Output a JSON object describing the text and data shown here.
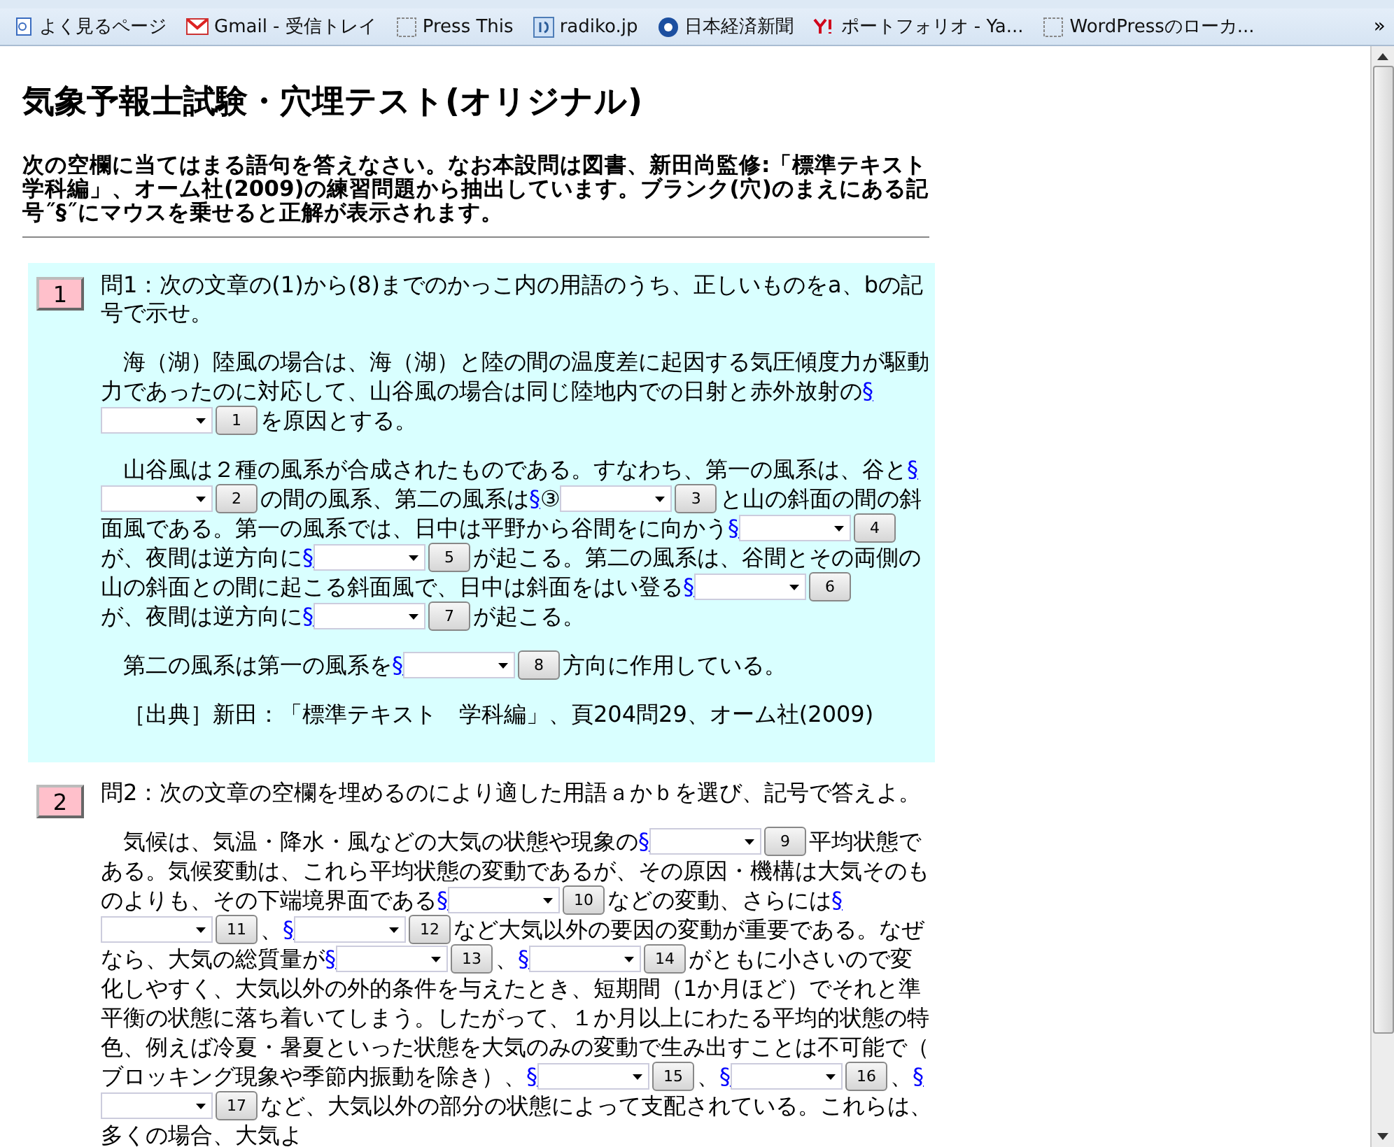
{
  "bookmarks": {
    "items": [
      {
        "label": "よく見るページ",
        "kind": "page"
      },
      {
        "label": "Gmail - 受信トレイ",
        "kind": "mail"
      },
      {
        "label": "Press This",
        "kind": "blank"
      },
      {
        "label": "radiko.jp",
        "kind": "radio"
      },
      {
        "label": "日本経済新聞",
        "kind": "news"
      },
      {
        "label": "ポートフォリオ - Ya...",
        "kind": "yahoo"
      },
      {
        "label": "WordPressのローカ...",
        "kind": "blank"
      }
    ],
    "more": "»"
  },
  "page": {
    "title": "気象予報士試験・穴埋テスト(オリジナル)",
    "intro": "次の空欄に当てはまる語句を答えなさい。なお本設問は図書、新田尚監修:「標準テキスト学科編」、オーム社(2009)の練習問題から抽出しています。ブランク(穴)のまえにある記号˝§˝にマウスを乗せると正解が表示されます。",
    "questions": [
      {
        "number": "1",
        "highlighted": true,
        "prompt": "問1：次の文章の(1)から(8)までのかっこ内の用語のうち、正しいものをa、bの記号で示せ。",
        "paragraphs": [
          [
            {
              "kind": "text",
              "text": "海（湖）陸風の場合は、海（湖）と陸の間の温度差に起因する気圧傾度力が駆動力であったのに対応して、山谷風の場合は同じ陸地内での日射と赤外放射の"
            },
            {
              "kind": "link",
              "text": "§"
            },
            {
              "kind": "blank",
              "button": "1"
            },
            {
              "kind": "text",
              "text": "を原因とする。"
            }
          ],
          [
            {
              "kind": "text",
              "text": "山谷風は２種の風系が合成されたものである。すなわち、第一の風系は、谷と"
            },
            {
              "kind": "link",
              "text": "§"
            },
            {
              "kind": "blank",
              "button": "2"
            },
            {
              "kind": "text",
              "text": "の間の風系、第二の風系は"
            },
            {
              "kind": "link",
              "text": "§"
            },
            {
              "kind": "text",
              "text": "③"
            },
            {
              "kind": "blank",
              "button": "3"
            },
            {
              "kind": "text",
              "text": "と山の斜面の間の斜面風である。第一の風系では、日中は平野から谷間をに向かう"
            },
            {
              "kind": "link",
              "text": "§"
            },
            {
              "kind": "blank",
              "button": "4"
            },
            {
              "kind": "text",
              "text": "が、夜間は逆方向に"
            },
            {
              "kind": "link",
              "text": "§"
            },
            {
              "kind": "blank",
              "button": "5"
            },
            {
              "kind": "text",
              "text": "が起こる。第二の風系は、谷間とその両側の山の斜面との間に起こる斜面風で、日中は斜面をはい登る"
            },
            {
              "kind": "link",
              "text": "§"
            },
            {
              "kind": "blank",
              "button": "6"
            },
            {
              "kind": "text",
              "text": "が、夜間は逆方向に"
            },
            {
              "kind": "link",
              "text": "§"
            },
            {
              "kind": "blank",
              "button": "7"
            },
            {
              "kind": "text",
              "text": "が起こる。"
            }
          ],
          [
            {
              "kind": "text",
              "text": "第二の風系は第一の風系を"
            },
            {
              "kind": "link",
              "text": "§"
            },
            {
              "kind": "blank",
              "button": "8"
            },
            {
              "kind": "text",
              "text": "方向に作用している。"
            }
          ],
          [
            {
              "kind": "text",
              "text": "［出典］新田：「標準テキスト　学科編」、頁204問29、オーム社(2009)"
            }
          ]
        ]
      },
      {
        "number": "2",
        "highlighted": false,
        "prompt": "問2：次の文章の空欄を埋めるのにより適した用語ａかｂを選び、記号で答えよ。",
        "paragraphs": [
          [
            {
              "kind": "text",
              "text": "気候は、気温・降水・風などの大気の状態や現象の"
            },
            {
              "kind": "link",
              "text": "§"
            },
            {
              "kind": "blank",
              "button": "9"
            },
            {
              "kind": "text",
              "text": "平均状態である。気候変動は、これら平均状態の変動であるが、その原因・機構は大気そのものよりも、その下端境界面である"
            },
            {
              "kind": "link",
              "text": "§"
            },
            {
              "kind": "blank",
              "button": "10"
            },
            {
              "kind": "text",
              "text": "などの変動、さらには"
            },
            {
              "kind": "link",
              "text": "§"
            },
            {
              "kind": "blank",
              "button": "11"
            },
            {
              "kind": "text",
              "text": "、"
            },
            {
              "kind": "link",
              "text": "§"
            },
            {
              "kind": "blank",
              "button": "12"
            },
            {
              "kind": "text",
              "text": "など大気以外の要因の変動が重要である。なぜなら、大気の総質量が"
            },
            {
              "kind": "link",
              "text": "§"
            },
            {
              "kind": "blank",
              "button": "13"
            },
            {
              "kind": "text",
              "text": "、"
            },
            {
              "kind": "link",
              "text": "§"
            },
            {
              "kind": "blank",
              "button": "14"
            },
            {
              "kind": "text",
              "text": "がともに小さいので変化しやすく、大気以外の外的条件を与えたとき、短期間（1か月ほど）でそれと準平衡の状態に落ち着いてしまう。したがって、１か月以上にわたる平均的状態の特色、例えば冷夏・暑夏といった状態を大気のみの変動で生み出すことは不可能で（ブロッキング現象や季節内振動を除き）、"
            },
            {
              "kind": "link",
              "text": "§"
            },
            {
              "kind": "blank",
              "button": "15"
            },
            {
              "kind": "text",
              "text": "、"
            },
            {
              "kind": "link",
              "text": "§"
            },
            {
              "kind": "blank",
              "button": "16"
            },
            {
              "kind": "text",
              "text": "、"
            },
            {
              "kind": "link",
              "text": "§"
            },
            {
              "kind": "blank",
              "button": "17"
            },
            {
              "kind": "text",
              "text": "など、大気以外の部分の状態によって支配されている。これらは、多くの場合、大気よ"
            }
          ]
        ]
      }
    ]
  }
}
